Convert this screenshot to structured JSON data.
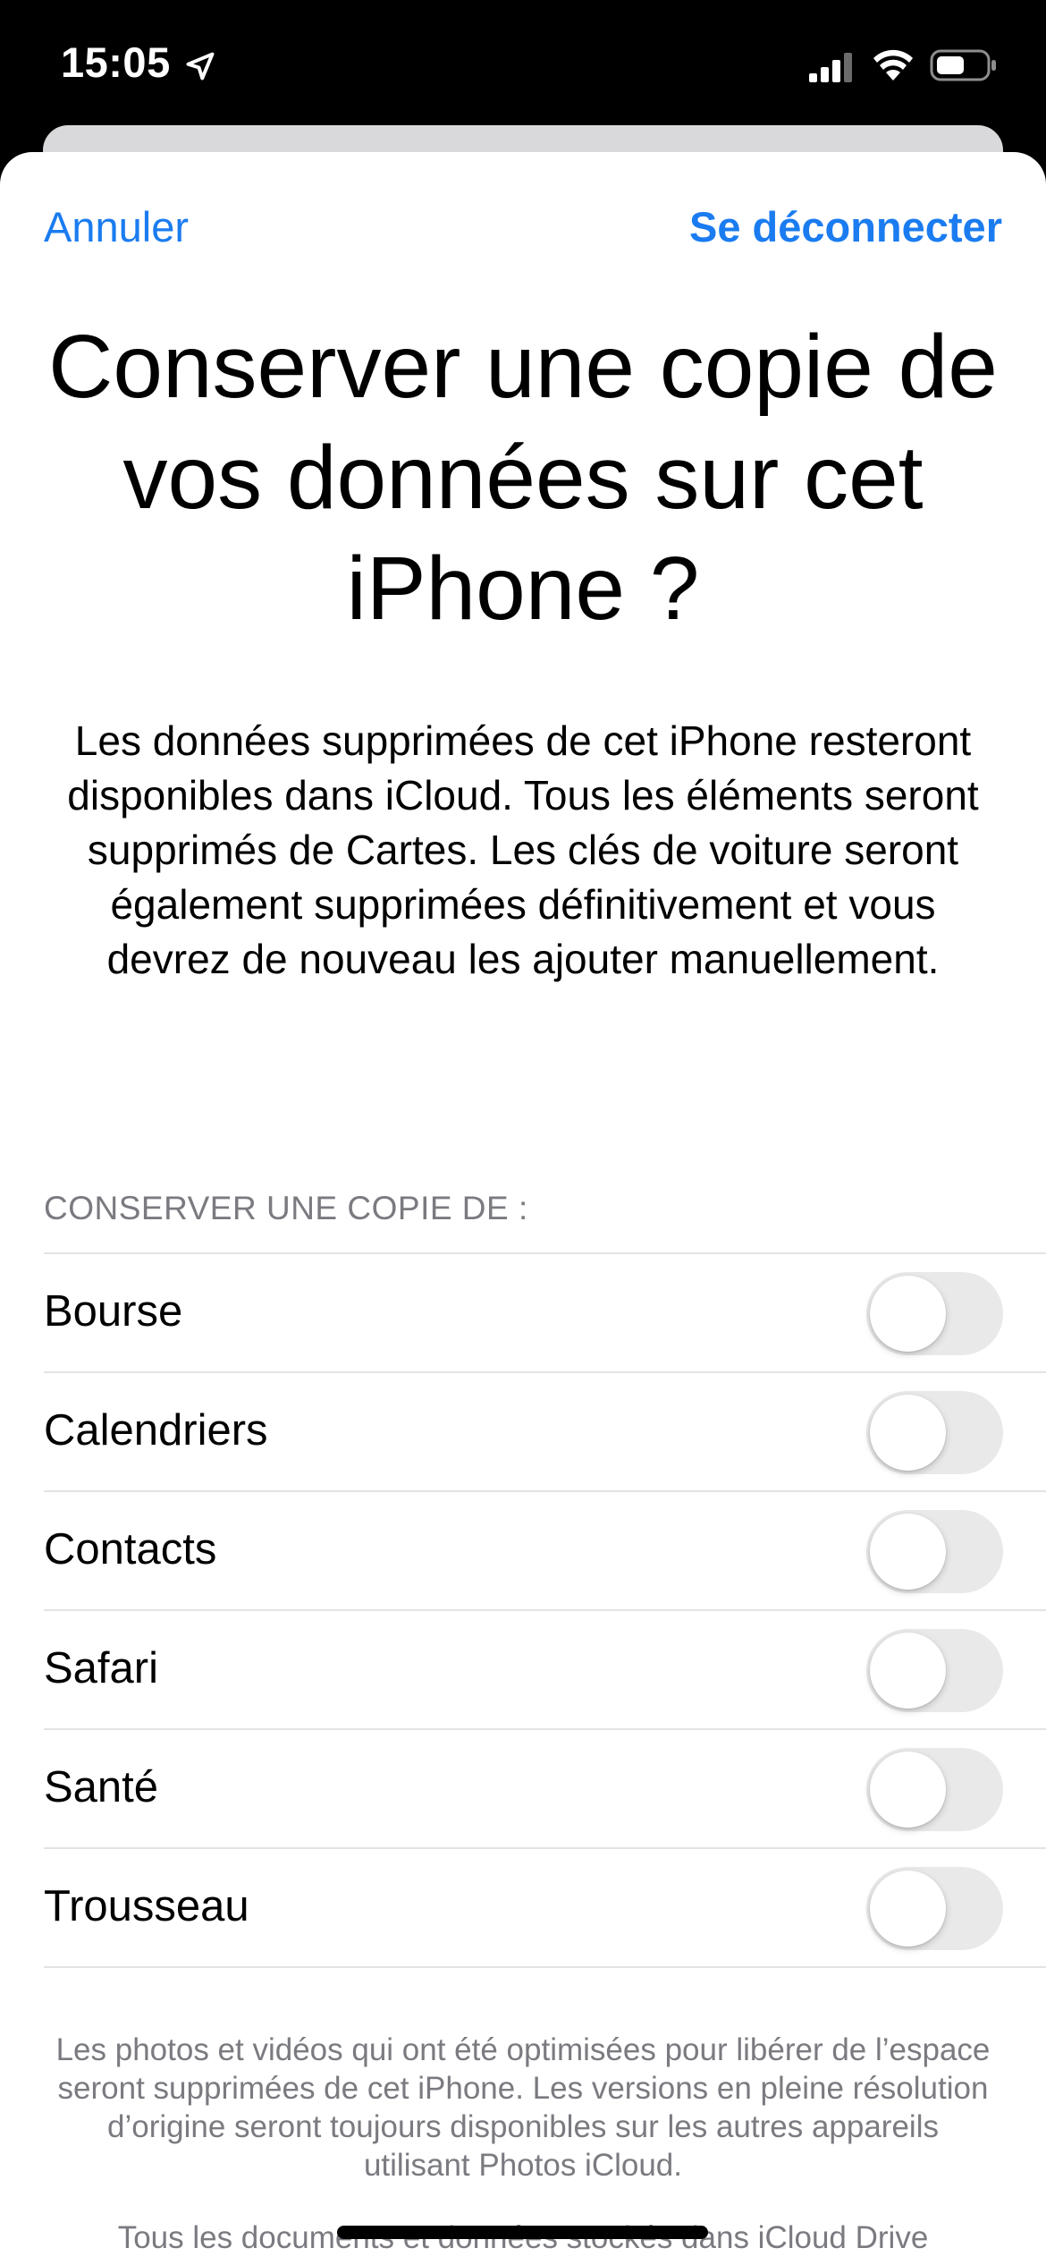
{
  "status_bar": {
    "time": "15:05",
    "icons": [
      "location-arrow-icon",
      "cellular-signal-icon",
      "wifi-icon",
      "battery-icon"
    ]
  },
  "nav": {
    "cancel_label": "Annuler",
    "signout_label": "Se déconnecter",
    "accent_color": "#1a7cf0"
  },
  "title": "Conserver une copie de vos données sur cet iPhone ?",
  "description": "Les données supprimées de cet iPhone resteront disponibles dans iCloud. Tous les éléments seront supprimés de Cartes. Les clés de voiture seront également supprimées définitivement et vous devrez de nouveau les ajouter manuellement.",
  "section_header": "CONSERVER UNE COPIE DE :",
  "items": [
    {
      "label": "Bourse",
      "enabled": false
    },
    {
      "label": "Calendriers",
      "enabled": false
    },
    {
      "label": "Contacts",
      "enabled": false
    },
    {
      "label": "Safari",
      "enabled": false
    },
    {
      "label": "Santé",
      "enabled": false
    },
    {
      "label": "Trousseau",
      "enabled": false
    }
  ],
  "footer": {
    "note": "Les photos et vidéos qui ont été optimisées pour libérer de l’espace seront supprimées de cet iPhone. Les versions en pleine résolution d’origine seront toujours disponibles sur les autres appareils utilisant Photos iCloud.",
    "note2": "Tous les documents et données stockés dans iCloud Drive"
  }
}
